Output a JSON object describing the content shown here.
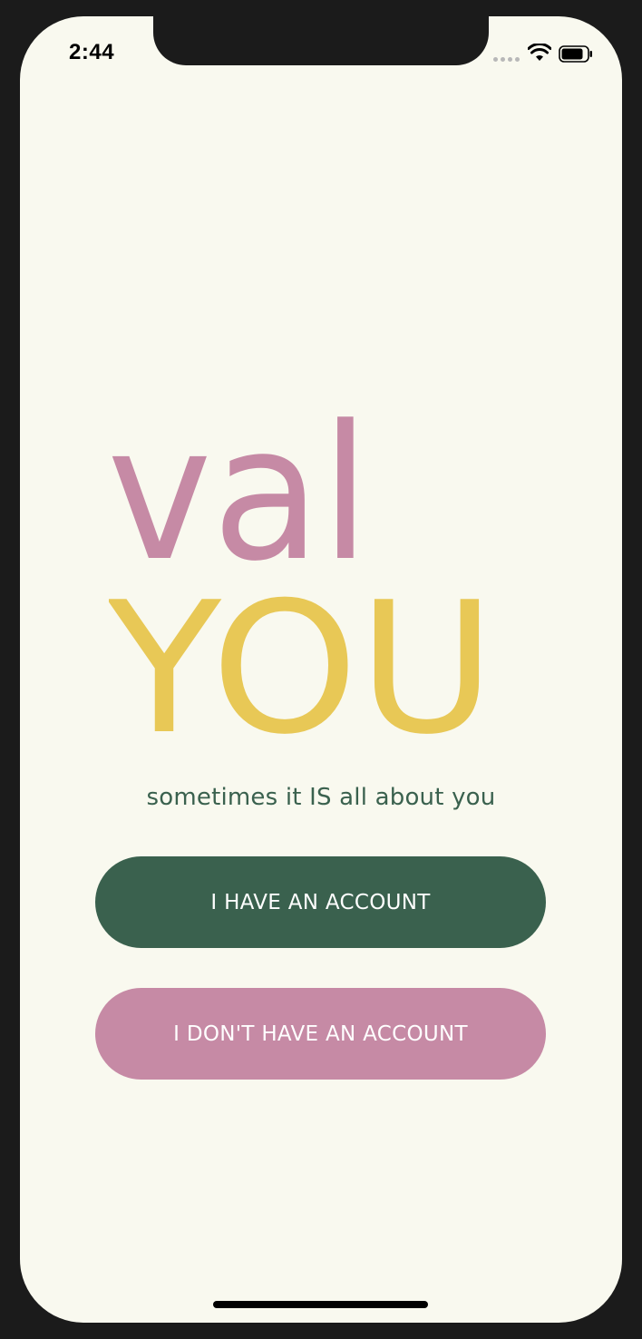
{
  "status_bar": {
    "time": "2:44"
  },
  "logo": {
    "line1": "val",
    "line2": "YOU",
    "line1_color": "#c68aa5",
    "line2_color": "#e8c856"
  },
  "tagline": "sometimes it IS all about you",
  "buttons": {
    "login_label": "I HAVE AN ACCOUNT",
    "signup_label": "I DON'T HAVE AN ACCOUNT"
  },
  "colors": {
    "background": "#f9f9ef",
    "primary_green": "#3a614e",
    "accent_pink": "#c68aa5",
    "accent_yellow": "#e8c856"
  },
  "icons": [
    "signal-dots-icon",
    "wifi-icon",
    "battery-icon"
  ]
}
